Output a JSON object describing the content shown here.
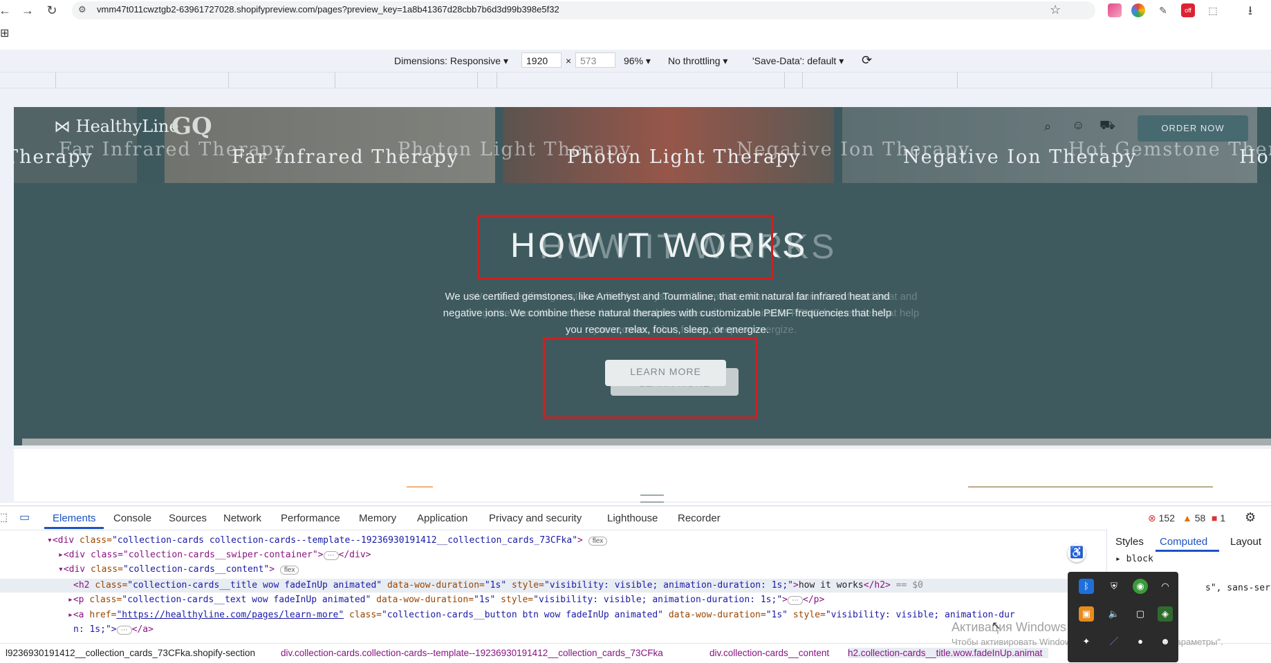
{
  "browser": {
    "url": "vmm47t011cwztgb2-63961727028.shopifypreview.com/pages?preview_key=1a8b41367d28cbb7b6d3d99b398e5f32",
    "back_icon": "←",
    "forward_icon": "→",
    "reload_icon": "↻",
    "site_info_icon": "⚙",
    "star_icon": "☆",
    "download_icon": "⭳",
    "apps_icon": "⊞"
  },
  "device_toolbar": {
    "dimensions_label": "Dimensions: Responsive",
    "width": "1920",
    "x_sep": "×",
    "height": "573",
    "zoom": "96%",
    "throttling": "No throttling",
    "save_data": "'Save-Data': default"
  },
  "site": {
    "logo_text": "HealthyLine",
    "press_logo": "GQ",
    "strip_labels": [
      "Far Infrared Therapy",
      "Photon Light Therapy",
      "Negative Ion Therapy",
      "Hot Gemstone Therapy"
    ],
    "strip_labels_ghost": [
      "Therapy",
      "Far Infrared Therapy",
      "Photon Light Therapy",
      "Negative Ion Therapy",
      "Hot Gemstone Therapy"
    ],
    "order_button": "ORDER NOW",
    "headline": "HOW IT WORKS",
    "description": "We use certified gemstones, like Amethyst and Tourmaline, that emit natural far infrared heat and negative ions. We combine these natural therapies with customizable PEMF frequencies that help you recover, relax, focus, sleep, or energize.",
    "learn_more": "LEARN MORE"
  },
  "devtools": {
    "tabs": [
      "Elements",
      "Console",
      "Sources",
      "Network",
      "Performance",
      "Memory",
      "Application",
      "Privacy and security",
      "Lighthouse",
      "Recorder"
    ],
    "errors": "152",
    "warnings": "58",
    "issues": "1",
    "side_tabs": [
      "Styles",
      "Computed",
      "Layout"
    ],
    "computed_value": "block",
    "computed_font": "s\", sans-serif",
    "code": {
      "line1_tag": "<div",
      "line1_attr": "class=",
      "line1_val": "\"collection-cards collection-cards--template--19236930191412__collection_cards_73CFka\"",
      "line1_end": ">",
      "line1_pill": "flex",
      "line2": "<div class=\"collection-cards__swiper-container\">",
      "line2_ellipsis": "⋯",
      "line2_end": "</div>",
      "line3_tag": "<div",
      "line3_attr": "class=",
      "line3_val": "\"collection-cards__content\"",
      "line3_end": ">",
      "line3_pill": "flex",
      "line4_tag": "<h2",
      "line4_attr": "class=",
      "line4_val": "\"collection-cards__title wow fadeInUp animated\"",
      "line4_attr2": "data-wow-duration=",
      "line4_val2": "\"1s\"",
      "line4_attr3": "style=",
      "line4_val3": "\"visibility: visible; animation-duration: 1s;\"",
      "line4_text": "how it works",
      "line4_end": "</h2>",
      "line4_ref": "== $0",
      "line5_tag": "<p",
      "line5_attr": "class=",
      "line5_val": "\"collection-cards__text wow fadeInUp animated\"",
      "line5_attr2": "data-wow-duration=",
      "line5_val2": "\"1s\"",
      "line5_attr3": "style=",
      "line5_val3": "\"visibility: visible; animation-duration: 1s;\"",
      "line5_end": "</p>",
      "line6_tag": "<a",
      "line6_attr": "href=",
      "line6_val": "\"https://healthyline.com/pages/learn-more\"",
      "line6_attr2": "class=",
      "line6_val2": "\"collection-cards__button btn wow fadeInUp animated\"",
      "line6_attr3": "data-wow-duration=",
      "line6_val3": "\"1s\"",
      "line6_attr4": "style=",
      "line6_val4": "\"visibility: visible; animation-dur",
      "line7": "n: 1s;\">",
      "line7_end": "</a>"
    },
    "breadcrumbs": [
      "l9236930191412__collection_cards_73CFka.shopify-section",
      "div.collection-cards.collection-cards--template--19236930191412__collection_cards_73CFka",
      "div.collection-cards__content",
      "h2.collection-cards__title.wow.fadeInUp.animat"
    ]
  },
  "os": {
    "watermark_title": "Активация Windows",
    "watermark_sub": "Чтобы активировать Windows, перейдите в раздел \"Параметры\"."
  },
  "colors": {
    "hero_bg": "#3e5a5f",
    "highlight": "#d01f1f",
    "devtools_accent": "#1a52c4"
  }
}
